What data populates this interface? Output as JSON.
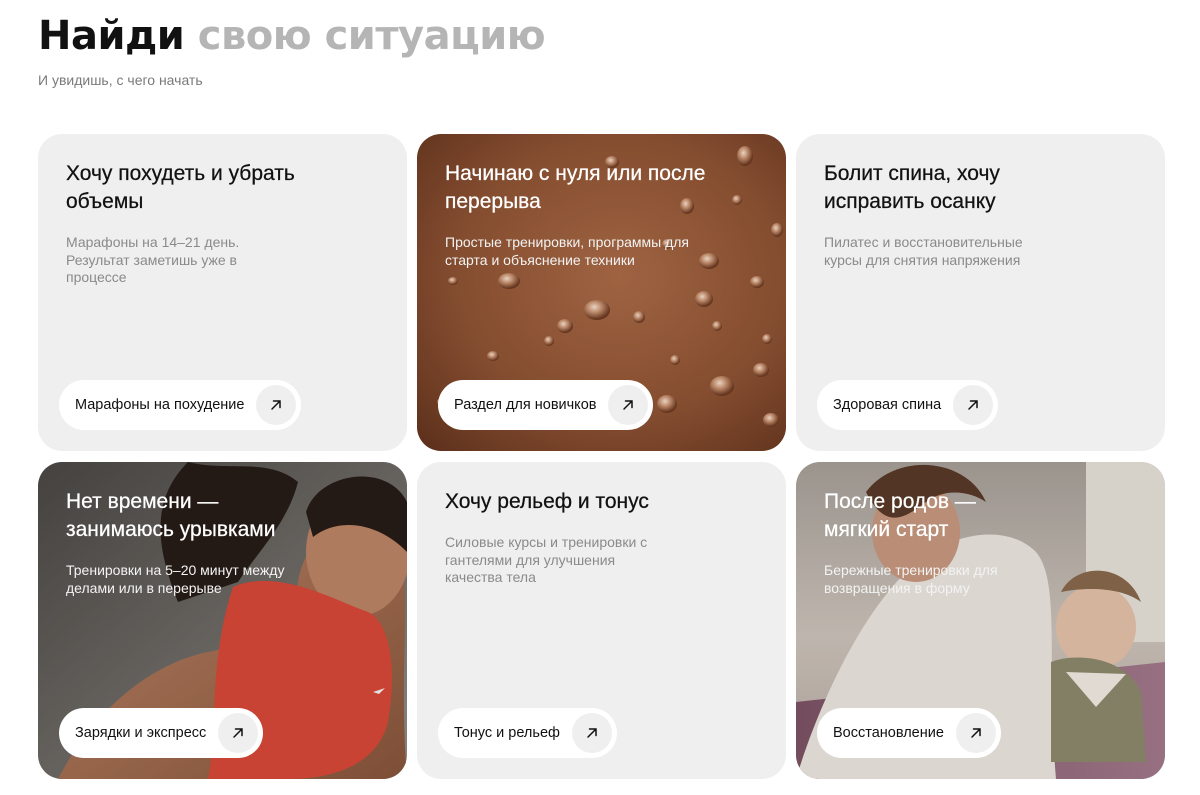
{
  "header": {
    "title_dark": "Найди",
    "title_light": "свою ситуацию",
    "subtitle": "И увидишь, с чего начать"
  },
  "cards": [
    {
      "title": "Хочу похудеть и убрать объемы",
      "description": "Марафоны на 14–21 день. Результат заметишь уже в процессе",
      "button": "Марафоны на похудение",
      "icon": "arrow-up-right-icon"
    },
    {
      "title": "Начинаю с нуля или после перерыва",
      "description": "Простые тренировки, программы для старта и объяснение техники",
      "button": "Раздел для новичков",
      "icon": "arrow-up-right-icon"
    },
    {
      "title": "Болит спина, хочу исправить осанку",
      "description": "Пилатес и восстановительные курсы для снятия напряжения",
      "button": "Здоровая спина",
      "icon": "arrow-up-right-icon"
    },
    {
      "title": "Нет времени — занимаюсь урывками",
      "description": "Тренировки на 5–20 минут между делами или в перерыве",
      "button": "Зарядки и экспресс",
      "icon": "arrow-up-right-icon"
    },
    {
      "title": "Хочу рельеф и тонус",
      "description": "Силовые курсы и тренировки с гантелями для улучшения качества тела",
      "button": "Тонус и рельеф",
      "icon": "arrow-up-right-icon"
    },
    {
      "title": "После родов — мягкий старт",
      "description": "Бережные тренировки для возвращения в форму",
      "button": "Восстановление",
      "icon": "arrow-up-right-icon"
    }
  ]
}
